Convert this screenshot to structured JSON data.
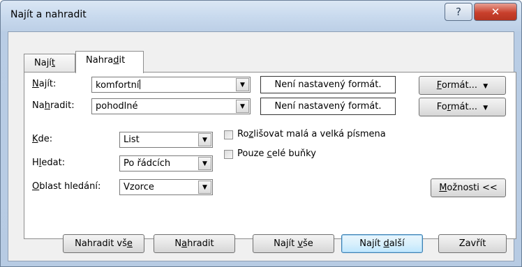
{
  "window": {
    "title": "Najít a nahradit",
    "help_icon": "?",
    "close_icon": "✕"
  },
  "tabs": [
    {
      "pre": "Nají",
      "key": "t",
      "post": "",
      "active": false
    },
    {
      "pre": "Nahra",
      "key": "d",
      "post": "it",
      "active": true
    }
  ],
  "find": {
    "label_key": "N",
    "label_rest": "ajít:",
    "value": "komfortní",
    "format_status": "Není nastavený formát.",
    "format_btn_key": "F",
    "format_btn_rest": "ormát...",
    "arrow": "▼"
  },
  "replace": {
    "label_pre": "Na",
    "label_key": "h",
    "label_rest": "radit:",
    "value": "pohodlné",
    "format_status": "Není nastavený formát.",
    "format_btn_pre": "Fo",
    "format_btn_key": "r",
    "format_btn_rest": "mát...",
    "arrow": "▼"
  },
  "options": {
    "within": {
      "label_key": "K",
      "label_rest": "de:",
      "value": "List"
    },
    "search": {
      "label_pre": "H",
      "label_key": "l",
      "label_rest": "edat:",
      "value": "Po řádcích"
    },
    "look_in": {
      "label_key": "O",
      "label_rest": "blast hledání:",
      "value": "Vzorce"
    },
    "match_case": {
      "label_pre": "Ro",
      "label_key": "z",
      "label_rest": "lišovat malá a velká písmena",
      "checked": false
    },
    "whole_cells": {
      "label_pre": "Pouze ",
      "label_key": "c",
      "label_rest": "elé buňky",
      "checked": false
    },
    "options_btn_key": "M",
    "options_btn_rest": "ožnosti <<"
  },
  "buttons": {
    "replace_all": {
      "pre": "Nahradit vš",
      "key": "e",
      "post": ""
    },
    "replace": {
      "pre": "N",
      "key": "a",
      "post": "hradit"
    },
    "find_all": {
      "pre": "Najít ",
      "key": "v",
      "post": "še"
    },
    "find_next": {
      "pre": "Najít ",
      "key": "d",
      "post": "alší"
    },
    "close": {
      "label": "Zavřít"
    }
  },
  "colors": {
    "titlebar": "#c9daee",
    "close_button": "#c9402c",
    "default_button_border": "#3c7fb1"
  }
}
